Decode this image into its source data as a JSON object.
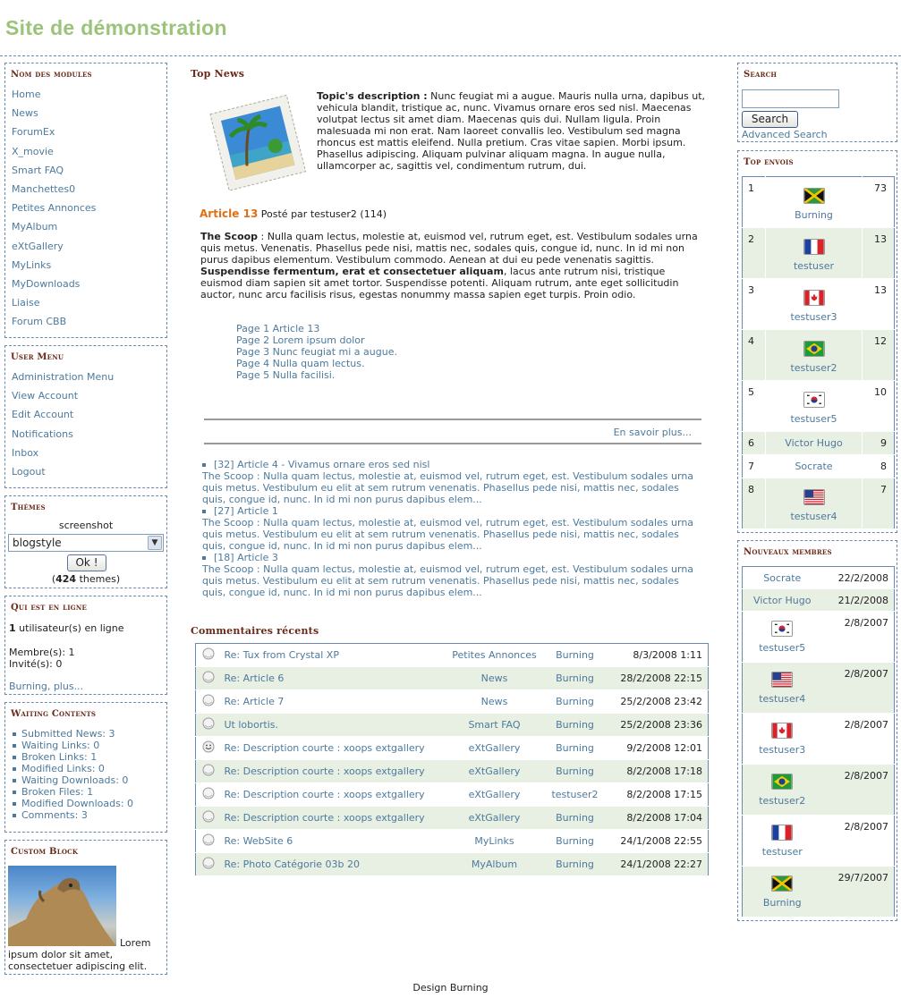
{
  "site": {
    "title": "Site de démonstration",
    "footer": "Design Burning"
  },
  "left": {
    "modules": {
      "title": "Nom des modules",
      "items": [
        "Home",
        "News",
        "ForumEx",
        "X_movie",
        "Smart FAQ",
        "Manchettes0",
        "Petites Annonces",
        "MyAlbum",
        "eXtGallery",
        "MyLinks",
        "MyDownloads",
        "Liaise",
        "Forum CBB"
      ]
    },
    "usermenu": {
      "title": "User Menu",
      "items": [
        "Administration Menu",
        "View Account",
        "Edit Account",
        "Notifications",
        "Inbox",
        "Logout"
      ]
    },
    "themes": {
      "title": "Thèmes",
      "label": "screenshot",
      "selected": "blogstyle",
      "button": "Ok !",
      "count_prefix": "(",
      "count": "424",
      "count_suffix": " themes)"
    },
    "online": {
      "title": "Qui est en ligne",
      "count": "1",
      "users_text": " utilisateur(s) en ligne",
      "members": "Membre(s): 1",
      "guests": "Invité(s): 0",
      "link": "Burning, plus..."
    },
    "waiting": {
      "title": "Waiting Contents",
      "items": [
        "Submitted News: 3",
        "Waiting Links: 0",
        "Broken Links: 1",
        "Modified Links: 0",
        "Waiting Downloads: 0",
        "Broken Files: 1",
        "Modified Downloads: 0",
        "Comments: 3"
      ]
    },
    "custom": {
      "title": "Custom Block",
      "text": "Lorem ipsum dolor sit amet, consectetuer adipiscing elit."
    }
  },
  "center": {
    "topnews": {
      "title": "Top News",
      "desc_label": "Topic's description :",
      "desc_text": " Nunc feugiat mi a augue. Mauris nulla urna, dapibus ut, vehicula blandit, tristique ac, nunc. Vivamus ornare eros sed nisl. Maecenas volutpat lectus sit amet diam. Maecenas quis dui. Nullam ligula. Proin malesuada mi non erat. Nam laoreet convallis leo. Vestibulum sed magna rhoncus est mattis eleifend. Nulla pretium. Cras vitae sapien. Morbi ipsum. Phasellus adipiscing. Aliquam pulvinar aliquam magna. In augue nulla, ullamcorper ac, sagittis vel, condimentum rutrum, dui.",
      "article_link": "Article 13",
      "posted_by": " Posté par testuser2 (114)",
      "scoop_label": "The Scoop",
      "scoop_text1": " : Nulla quam lectus, molestie at, euismod vel, rutrum eget, est. Vestibulum sodales urna quis metus. Venenatis. Phasellus pede nisi, mattis nec, sodales quis, congue id, nunc. In id mi non purus dapibus elementum. Vestibulum commodo. Aenean at dui eu pede venenatis sagittis. ",
      "scoop_bold": "Suspendisse fermentum, erat et consectetuer aliquam",
      "scoop_text2": ", lacus ante rutrum nisi, tristique euismod diam sapien sit amet tortor. Suspendisse potenti. Aliquam rutrum, ante eget sollicitudin auctor, nunc arcu facilisis risus, egestas nonummy massa sapien eget turpis. Proin odio.",
      "pages": [
        "Page 1 Article 13",
        "Page 2 Lorem ipsum dolor",
        "Page 3 Nunc feugiat mi a augue.",
        "Page 4 Nulla quam lectus.",
        "Page 5 Nulla facilisi."
      ],
      "read_more": "En savoir plus...",
      "more": [
        {
          "title": "[32] Article 4 - Vivamus ornare eros sed nisl",
          "text": "The Scoop : Nulla quam lectus, molestie at, euismod vel, rutrum eget, est. Vestibulum sodales urna quis metus. Vestibulum eu elit at sem rutrum venenatis. Phasellus pede nisi, mattis nec, sodales quis, congue id, nunc. In id mi non purus dapibus elem..."
        },
        {
          "title": "[27] Article 1",
          "text": "The Scoop : Nulla quam lectus, molestie at, euismod vel, rutrum eget, est. Vestibulum sodales urna quis metus. Vestibulum eu elit at sem rutrum venenatis. Phasellus pede nisi, mattis nec, sodales quis, congue id, nunc. In id mi non purus dapibus elem..."
        },
        {
          "title": "[18] Article 3",
          "text": "The Scoop : Nulla quam lectus, molestie at, euismod vel, rutrum eget, est. Vestibulum sodales urna quis metus. Vestibulum eu elit at sem rutrum venenatis. Phasellus pede nisi, mattis nec, sodales quis, congue id, nunc. In id mi non purus dapibus elem..."
        }
      ]
    },
    "comments": {
      "title": "Commentaires récents",
      "rows": [
        {
          "icon": "circle",
          "title": "Re: Tux from Crystal XP",
          "module": "Petites Annonces",
          "user": "Burning",
          "date": "8/3/2008 1:11"
        },
        {
          "icon": "circle",
          "title": "Re: Article 6",
          "module": "News",
          "user": "Burning",
          "date": "28/2/2008 22:15"
        },
        {
          "icon": "circle",
          "title": "Re: Article 7",
          "module": "News",
          "user": "Burning",
          "date": "25/2/2008 23:42"
        },
        {
          "icon": "circle",
          "title": "Ut lobortis.",
          "module": "Smart FAQ",
          "user": "Burning",
          "date": "25/2/2008 23:36"
        },
        {
          "icon": "smiley",
          "title": "Re: Description courte : xoops extgallery",
          "module": "eXtGallery",
          "user": "Burning",
          "date": "9/2/2008 12:01"
        },
        {
          "icon": "circle",
          "title": "Re: Description courte : xoops extgallery",
          "module": "eXtGallery",
          "user": "Burning",
          "date": "8/2/2008 17:18"
        },
        {
          "icon": "circle",
          "title": "Re: Description courte : xoops extgallery",
          "module": "eXtGallery",
          "user": "testuser2",
          "date": "8/2/2008 17:15"
        },
        {
          "icon": "circle",
          "title": "Re: Description courte : xoops extgallery",
          "module": "eXtGallery",
          "user": "Burning",
          "date": "8/2/2008 17:04"
        },
        {
          "icon": "circle",
          "title": "Re: WebSite 6",
          "module": "MyLinks",
          "user": "Burning",
          "date": "24/1/2008 22:55"
        },
        {
          "icon": "circle",
          "title": "Re: Photo Catégorie 03b 20",
          "module": "MyAlbum",
          "user": "Burning",
          "date": "24/1/2008 22:27"
        }
      ]
    }
  },
  "right": {
    "search": {
      "title": "Search",
      "value": "",
      "button": "Search",
      "advanced": "Advanced Search"
    },
    "top": {
      "title": "Top envois",
      "rows": [
        {
          "rank": "1",
          "flag": "jamaica",
          "name": "Burning",
          "count": "73"
        },
        {
          "rank": "2",
          "flag": "france",
          "name": "testuser",
          "count": "13"
        },
        {
          "rank": "3",
          "flag": "canada",
          "name": "testuser3",
          "count": "13"
        },
        {
          "rank": "4",
          "flag": "brazil",
          "name": "testuser2",
          "count": "12"
        },
        {
          "rank": "5",
          "flag": "korea",
          "name": "testuser5",
          "count": "10"
        },
        {
          "rank": "6",
          "flag": "",
          "name": "Victor Hugo",
          "count": "9"
        },
        {
          "rank": "7",
          "flag": "",
          "name": "Socrate",
          "count": "8"
        },
        {
          "rank": "8",
          "flag": "usa",
          "name": "testuser4",
          "count": "7"
        }
      ]
    },
    "newmembers": {
      "title": "Nouveaux membres",
      "rows": [
        {
          "flag": "",
          "name": "Socrate",
          "date": "22/2/2008"
        },
        {
          "flag": "",
          "name": "Victor Hugo",
          "date": "21/2/2008"
        },
        {
          "flag": "korea",
          "name": "testuser5",
          "date": "2/8/2007"
        },
        {
          "flag": "usa",
          "name": "testuser4",
          "date": "2/8/2007"
        },
        {
          "flag": "canada",
          "name": "testuser3",
          "date": "2/8/2007"
        },
        {
          "flag": "brazil",
          "name": "testuser2",
          "date": "2/8/2007"
        },
        {
          "flag": "france",
          "name": "testuser",
          "date": "2/8/2007"
        },
        {
          "flag": "jamaica",
          "name": "Burning",
          "date": "29/7/2007"
        }
      ]
    }
  }
}
